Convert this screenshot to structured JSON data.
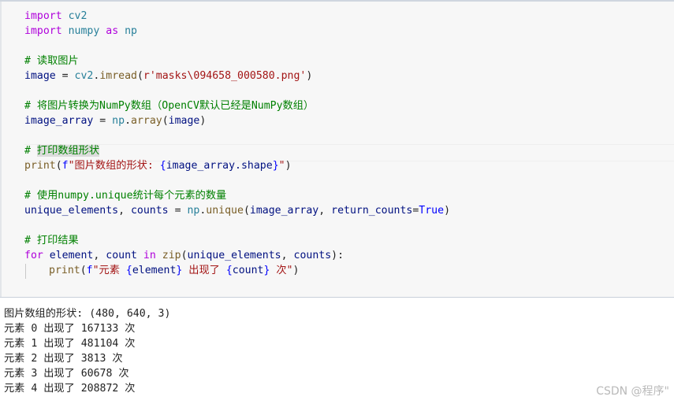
{
  "code": {
    "l1": {
      "kw": "import",
      "mod": "cv2"
    },
    "l2": {
      "kw": "import",
      "mod": "numpy",
      "as": "as",
      "alias": "np"
    },
    "l3": {
      "comment": "# 读取图片"
    },
    "l4": {
      "var": "image",
      "eq": " = ",
      "obj": "cv2",
      "dot": ".",
      "fn": "imread",
      "open": "(",
      "str": "r'masks\\094658_000580.png'",
      "close": ")"
    },
    "l5": {
      "comment": "# 将图片转换为NumPy数组（OpenCV默认已经是NumPy数组）"
    },
    "l6": {
      "var": "image_array",
      "eq": " = ",
      "obj": "np",
      "dot": ".",
      "fn": "array",
      "open": "(",
      "arg": "image",
      "close": ")"
    },
    "l7": {
      "comment_hash": "# ",
      "comment_hl": "打印数组形状"
    },
    "l8": {
      "fn": "print",
      "open": "(",
      "f": "f",
      "str1": "\"图片数组的形状: ",
      "interp_open": "{",
      "expr": "image_array.shape",
      "interp_close": "}",
      "str2": "\"",
      "close": ")"
    },
    "l9": {
      "comment": "# 使用numpy.unique统计每个元素的数量"
    },
    "l10": {
      "v1": "unique_elements",
      "comma": ", ",
      "v2": "counts",
      "eq": " = ",
      "obj": "np",
      "dot": ".",
      "fn": "unique",
      "open": "(",
      "arg": "image_array",
      "comma2": ", ",
      "kw": "return_counts",
      "eqk": "=",
      "val": "True",
      "close": ")"
    },
    "l11": {
      "comment": "# 打印结果"
    },
    "l12": {
      "kw": "for",
      "v1": "element",
      "comma": ", ",
      "v2": "count",
      "in": "in",
      "fn": "zip",
      "open": "(",
      "a1": "unique_elements",
      "comma2": ", ",
      "a2": "counts",
      "close": "):"
    },
    "l13": {
      "fn": "print",
      "open": "(",
      "f": "f",
      "s1": "\"元素 ",
      "i1o": "{",
      "e1": "element",
      "i1c": "}",
      "s2": " 出现了 ",
      "i2o": "{",
      "e2": "count",
      "i2c": "}",
      "s3": " 次\"",
      "close": ")"
    }
  },
  "output": [
    "图片数组的形状: (480, 640, 3)",
    "元素 0 出现了 167133 次",
    "元素 1 出现了 481104 次",
    "元素 2 出现了 3813 次",
    "元素 3 出现了 60678 次",
    "元素 4 出现了 208872 次"
  ],
  "watermark": "CSDN @程序\""
}
